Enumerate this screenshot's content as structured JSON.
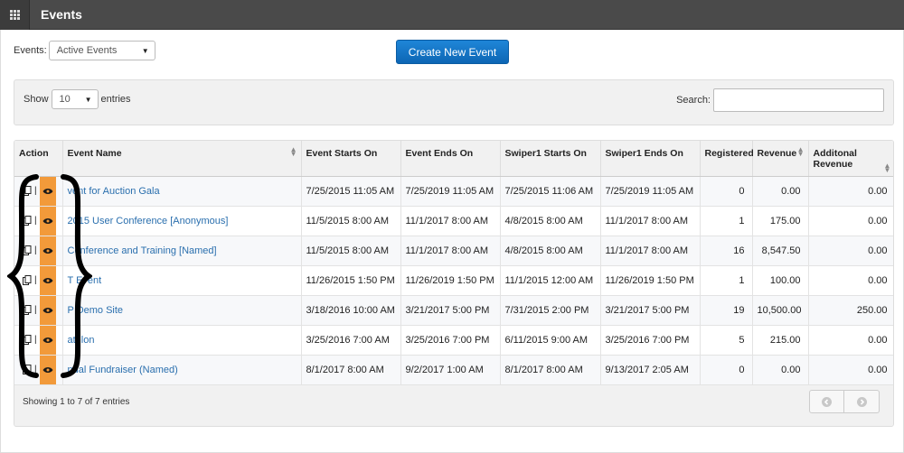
{
  "header": {
    "title": "Events"
  },
  "filter": {
    "label": "Events:",
    "selected": "Active Events"
  },
  "create_button": "Create New Event",
  "length": {
    "show": "Show",
    "value": "10",
    "entries": "entries"
  },
  "search": {
    "label": "Search:",
    "value": ""
  },
  "table": {
    "columns": [
      "Action",
      "Event Name",
      "Event Starts On",
      "Event Ends On",
      "Swiper1 Starts On",
      "Swiper1 Ends On",
      "Registered",
      "Revenue",
      "Additonal Revenue"
    ],
    "action_separator": "|",
    "rows": [
      {
        "name": "vent for Auction Gala",
        "start": "7/25/2015 11:05 AM",
        "end": "7/25/2019 11:05 AM",
        "sw_start": "7/25/2015 11:06 AM",
        "sw_end": "7/25/2019 11:05 AM",
        "registered": "0",
        "revenue": "0.00",
        "add_revenue": "0.00"
      },
      {
        "name": "2015 User Conference [Anonymous]",
        "start": "11/5/2015 8:00 AM",
        "end": "11/1/2017 8:00 AM",
        "sw_start": "4/8/2015 8:00 AM",
        "sw_end": "11/1/2017 8:00 AM",
        "registered": "1",
        "revenue": "175.00",
        "add_revenue": "0.00"
      },
      {
        "name": "Conference and Training [Named]",
        "start": "11/5/2015 8:00 AM",
        "end": "11/1/2017 8:00 AM",
        "sw_start": "4/8/2015 8:00 AM",
        "sw_end": "11/1/2017 8:00 AM",
        "registered": "16",
        "revenue": "8,547.50",
        "add_revenue": "0.00"
      },
      {
        "name": "T  Event",
        "start": "11/26/2015 1:50 PM",
        "end": "11/26/2019 1:50 PM",
        "sw_start": "11/1/2015 12:00 AM",
        "sw_end": "11/26/2019 1:50 PM",
        "registered": "1",
        "revenue": "100.00",
        "add_revenue": "0.00"
      },
      {
        "name": "P Demo Site",
        "start": "3/18/2016 10:00 AM",
        "end": "3/21/2017 5:00 PM",
        "sw_start": "7/31/2015 2:00 PM",
        "sw_end": "3/21/2017 5:00 PM",
        "registered": "19",
        "revenue": "10,500.00",
        "add_revenue": "250.00"
      },
      {
        "name": "athlon",
        "start": "3/25/2016 7:00 AM",
        "end": "3/25/2016 7:00 PM",
        "sw_start": "6/11/2015 9:00 AM",
        "sw_end": "3/25/2016 7:00 PM",
        "registered": "5",
        "revenue": "215.00",
        "add_revenue": "0.00"
      },
      {
        "name": "nual Fundraiser (Named)",
        "start": "8/1/2017 8:00 AM",
        "end": "9/2/2017 1:00 AM",
        "sw_start": "8/1/2017 8:00 AM",
        "sw_end": "9/13/2017 2:05 AM",
        "registered": "0",
        "revenue": "0.00",
        "add_revenue": "0.00"
      }
    ]
  },
  "footer": {
    "info": "Showing 1 to 7 of 7 entries"
  },
  "colors": {
    "header_bg": "#4a4a4a",
    "primary_button": "#1976c9",
    "view_highlight": "#f29a3a",
    "link": "#2a6fae"
  },
  "icons": {
    "apps": "grid-icon",
    "copy": "copy-icon",
    "view": "eye-icon",
    "prev": "arrow-left-icon",
    "next": "arrow-right-icon"
  }
}
